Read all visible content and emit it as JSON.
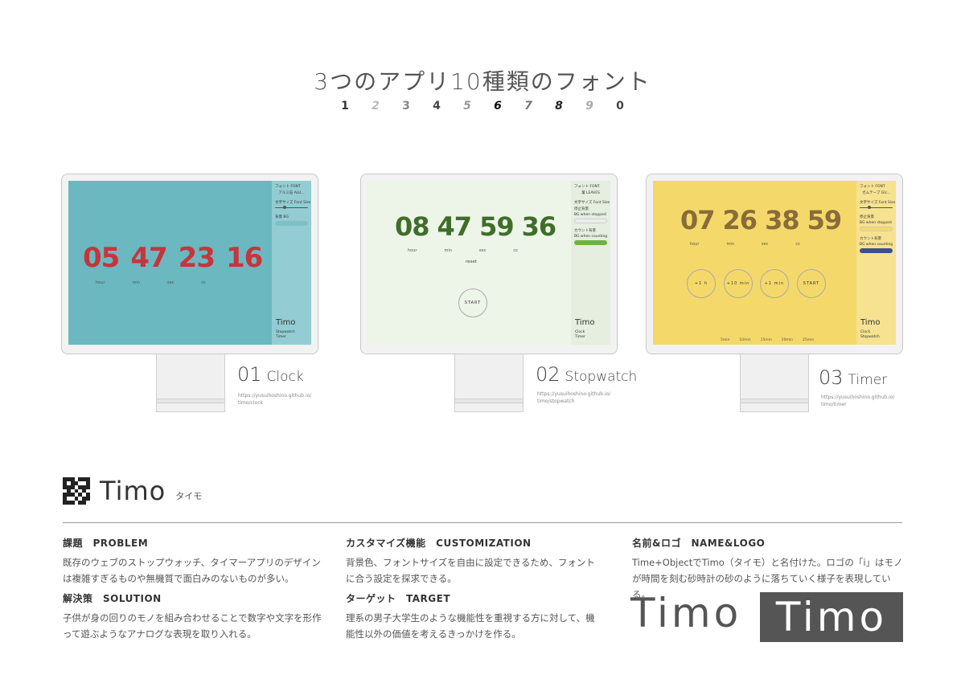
{
  "header": {
    "title": "3つのアプリ10種類のフォント",
    "digits": [
      "1",
      "2",
      "3",
      "4",
      "5",
      "6",
      "7",
      "8",
      "9",
      "0"
    ]
  },
  "apps": [
    {
      "caption_num": "01",
      "caption_name": "Clock",
      "url_line1": "https://yusuihoshino.github.io/",
      "url_line2": "timo/clock",
      "bg": "#6bb8c0",
      "side_bg": "#93cdd3",
      "digit_color": "#c8343c",
      "time": [
        "05",
        "47",
        "23",
        "16"
      ],
      "units": [
        "hour",
        "min",
        "sec",
        "cs"
      ],
      "side": {
        "font_label": "フォント FONT",
        "font_value": "アルミ缶 ALU...",
        "size_label": "文字サイズ Font Size",
        "bg_label": "背景 BG",
        "swatch": "#7fbfc6"
      },
      "brand": "Timo",
      "links": [
        "Stopwatch",
        "Timer"
      ]
    },
    {
      "caption_num": "02",
      "caption_name": "Stopwatch",
      "url_line1": "https://yusuihoshino.github.io/",
      "url_line2": "timo/stopwatch",
      "bg": "#edf4e8",
      "side_bg": "#e5eedf",
      "digit_color": "#3f6e2a",
      "time": [
        "08",
        "47",
        "59",
        "36"
      ],
      "units": [
        "hour",
        "min",
        "sec",
        "cs"
      ],
      "reset": "reset",
      "start": "START",
      "side": {
        "font_label": "フォント FONT",
        "font_value": "葉 LEAVES",
        "size_label": "文字サイズ Font Size",
        "stop_label": "停止背景",
        "stop_label2": "BG when stopped",
        "count_label": "カウント背景",
        "count_label2": "BG when counting",
        "swatch_stop": "#e9f0e4",
        "swatch_count": "#6fb33f"
      },
      "brand": "Timo",
      "links": [
        "Clock",
        "Timer"
      ]
    },
    {
      "caption_num": "03",
      "caption_name": "Timer",
      "url_line1": "https://yusuihoshino.github.io/",
      "url_line2": "timo/timer",
      "bg": "#f4d96a",
      "side_bg": "#f6e290",
      "digit_color": "#8a6b3a",
      "time": [
        "07",
        "26",
        "38",
        "59"
      ],
      "units": [
        "hour",
        "min",
        "sec",
        "cs"
      ],
      "buttons": [
        "+1 h",
        "+10 min",
        "+1 min",
        "START"
      ],
      "presets": [
        "5min",
        "10min",
        "15min",
        "20min",
        "25min"
      ],
      "side": {
        "font_label": "フォント FONT",
        "font_value": "ガムテープ GU...",
        "size_label": "文字サイズ Font Size",
        "stop_label": "停止背景",
        "stop_label2": "BG when stopped",
        "count_label": "カウント背景",
        "count_label2": "BG when counting",
        "swatch_stop": "#f4d96a",
        "swatch_count": "#3a4f8c"
      },
      "brand": "Timo",
      "links": [
        "Clock",
        "Stopwatch"
      ]
    }
  ],
  "brand_row": {
    "logo": "Timo",
    "sub": "タイモ"
  },
  "sections": {
    "problem": {
      "title": "課題　PROBLEM",
      "text": "既存のウェブのストップウォッチ、タイマーアプリのデザインは複雑すぎるものや無機質で面白みのないものが多い。"
    },
    "solution": {
      "title": "解決策　SOLUTION",
      "text": "子供が身の回りのモノを組み合わせることで数字や文字を形作って遊ぶようなアナログな表現を取り入れる。"
    },
    "customization": {
      "title": "カスタマイズ機能　CUSTOMIZATION",
      "text": "背景色、フォントサイズを自由に設定できるため、フォントに合う設定を探求できる。"
    },
    "target": {
      "title": "ターゲット　TARGET",
      "text": "理系の男子大学生のような機能性を重視する方に対して、機能性以外の価値を考えるきっかけを作る。"
    },
    "name_logo": {
      "title": "名前&ロゴ　NAME&LOGO",
      "text": "Time+ObjectでTimo（タイモ）と名付けた。ロゴの「i」はモノが時間を刻む砂時計の砂のように落ちていく様子を表現している。"
    }
  },
  "logos": {
    "light": "Timo",
    "dark": "Timo",
    "i_dot_color": "#8a7a3a",
    "i_stem_color": "#555555"
  }
}
